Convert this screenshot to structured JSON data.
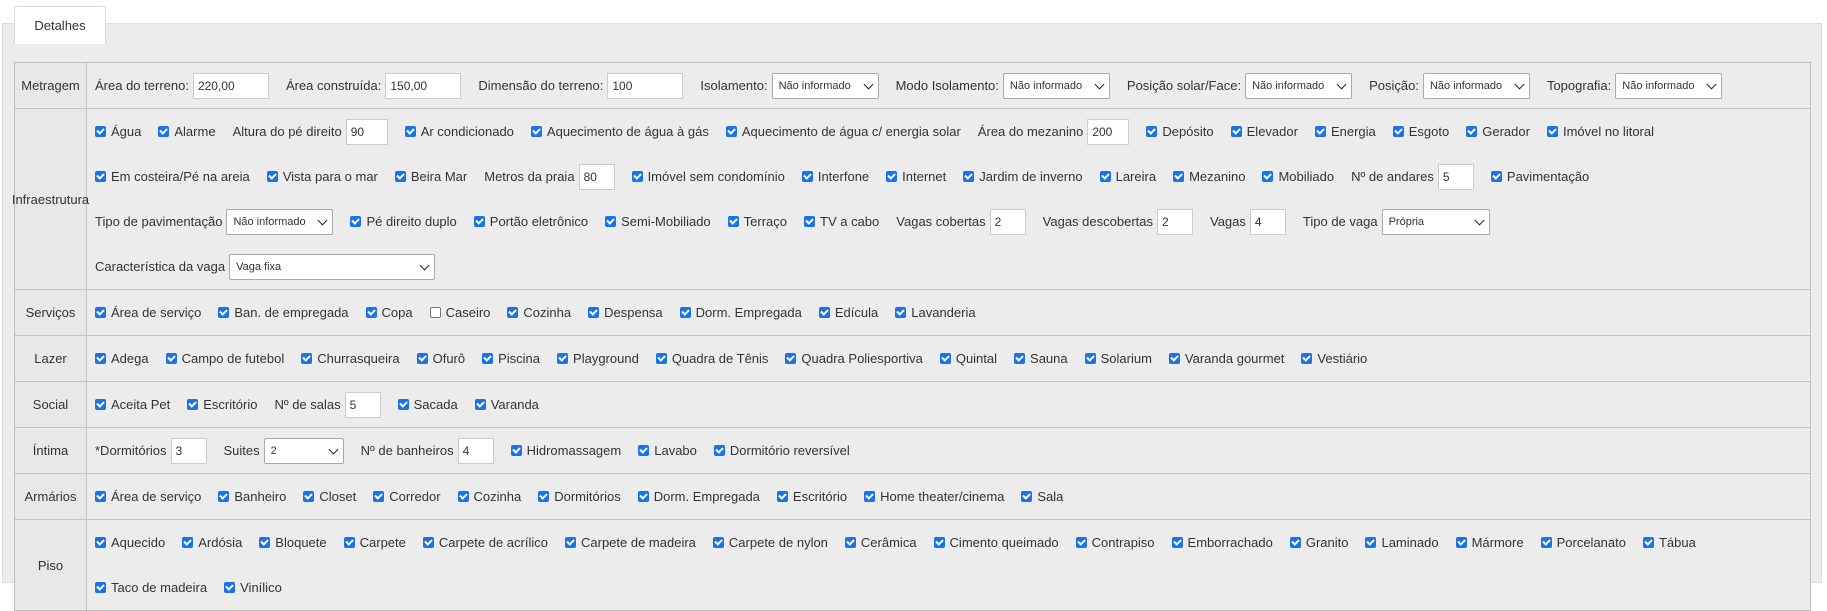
{
  "tab_label": "Detalhes",
  "rows": [
    {
      "label": "Metragem",
      "items": [
        {
          "type": "input",
          "label": "Área do terreno:",
          "value": "220,00",
          "w": 76
        },
        {
          "type": "input",
          "label": "Área construída:",
          "value": "150,00",
          "w": 76
        },
        {
          "type": "input",
          "label": "Dimensão do terreno:",
          "value": "100",
          "w": 76
        },
        {
          "type": "select",
          "label": "Isolamento:",
          "value": "Não informado",
          "w": 107
        },
        {
          "type": "select",
          "label": "Modo Isolamento:",
          "value": "Não informado",
          "w": 107
        },
        {
          "type": "select",
          "label": "Posição solar/Face:",
          "value": "Não informado",
          "w": 107
        },
        {
          "type": "select",
          "label": "Posição:",
          "value": "Não informado",
          "w": 107
        },
        {
          "type": "select",
          "label": "Topografia:",
          "value": "Não informado",
          "w": 107
        }
      ]
    },
    {
      "label": "Infraestrutura",
      "items": [
        {
          "type": "check",
          "label": "Água",
          "checked": true
        },
        {
          "type": "check",
          "label": "Alarme",
          "checked": true
        },
        {
          "type": "input",
          "label": "Altura do pé direito",
          "value": "90",
          "w": 42
        },
        {
          "type": "check",
          "label": "Ar condicionado",
          "checked": true
        },
        {
          "type": "check",
          "label": "Aquecimento de água à gás",
          "checked": true
        },
        {
          "type": "check",
          "label": "Aquecimento de água c/ energia solar",
          "checked": true
        },
        {
          "type": "input",
          "label": "Área do mezanino",
          "value": "200",
          "w": 42
        },
        {
          "type": "check",
          "label": "Depósito",
          "checked": true
        },
        {
          "type": "check",
          "label": "Elevador",
          "checked": true
        },
        {
          "type": "check",
          "label": "Energia",
          "checked": true
        },
        {
          "type": "check",
          "label": "Esgoto",
          "checked": true
        },
        {
          "type": "check",
          "label": "Gerador",
          "checked": true
        },
        {
          "type": "check",
          "label": "Imóvel no litoral",
          "checked": true
        },
        {
          "type": "check",
          "label": "Em costeira/Pé na areia",
          "checked": true
        },
        {
          "type": "check",
          "label": "Vista para o mar",
          "checked": true
        },
        {
          "type": "check",
          "label": "Beira Mar",
          "checked": true
        },
        {
          "type": "input",
          "label": "Metros da praia",
          "value": "80",
          "w": 36
        },
        {
          "type": "check",
          "label": "Imóvel sem condomínio",
          "checked": true
        },
        {
          "type": "check",
          "label": "Interfone",
          "checked": true
        },
        {
          "type": "check",
          "label": "Internet",
          "checked": true
        },
        {
          "type": "check",
          "label": "Jardim de inverno",
          "checked": true
        },
        {
          "type": "check",
          "label": "Lareira",
          "checked": true
        },
        {
          "type": "check",
          "label": "Mezanino",
          "checked": true
        },
        {
          "type": "check",
          "label": "Mobiliado",
          "checked": true
        },
        {
          "type": "input",
          "label": "Nº de andares",
          "value": "5",
          "w": 36
        },
        {
          "type": "check",
          "label": "Pavimentação",
          "checked": true
        },
        {
          "type": "select",
          "label": "Tipo de pavimentação",
          "value": "Não informado",
          "w": 107
        },
        {
          "type": "check",
          "label": "Pé direito duplo",
          "checked": true
        },
        {
          "type": "check",
          "label": "Portão eletrônico",
          "checked": true
        },
        {
          "type": "check",
          "label": "Semi-Mobiliado",
          "checked": true
        },
        {
          "type": "check",
          "label": "Terraço",
          "checked": true
        },
        {
          "type": "check",
          "label": "TV a cabo",
          "checked": true
        },
        {
          "type": "input",
          "label": "Vagas cobertas",
          "value": "2",
          "w": 36
        },
        {
          "type": "input",
          "label": "Vagas descobertas",
          "value": "2",
          "w": 36
        },
        {
          "type": "input",
          "label": "Vagas",
          "value": "4",
          "w": 36
        },
        {
          "type": "select",
          "label": "Tipo de vaga",
          "value": "Própria",
          "w": 108
        },
        {
          "type": "select",
          "label": "Característica da vaga",
          "value": "Vaga fixa",
          "w": 206
        }
      ]
    },
    {
      "label": "Serviços",
      "items": [
        {
          "type": "check",
          "label": "Área de serviço",
          "checked": true
        },
        {
          "type": "check",
          "label": "Ban. de empregada",
          "checked": true
        },
        {
          "type": "check",
          "label": "Copa",
          "checked": true
        },
        {
          "type": "check",
          "label": "Caseiro",
          "checked": false
        },
        {
          "type": "check",
          "label": "Cozinha",
          "checked": true
        },
        {
          "type": "check",
          "label": "Despensa",
          "checked": true
        },
        {
          "type": "check",
          "label": "Dorm. Empregada",
          "checked": true
        },
        {
          "type": "check",
          "label": "Edícula",
          "checked": true
        },
        {
          "type": "check",
          "label": "Lavanderia",
          "checked": true
        }
      ]
    },
    {
      "label": "Lazer",
      "items": [
        {
          "type": "check",
          "label": "Adega",
          "checked": true
        },
        {
          "type": "check",
          "label": "Campo de futebol",
          "checked": true
        },
        {
          "type": "check",
          "label": "Churrasqueira",
          "checked": true
        },
        {
          "type": "check",
          "label": "Ofurô",
          "checked": true
        },
        {
          "type": "check",
          "label": "Piscina",
          "checked": true
        },
        {
          "type": "check",
          "label": "Playground",
          "checked": true
        },
        {
          "type": "check",
          "label": "Quadra de Tênis",
          "checked": true
        },
        {
          "type": "check",
          "label": "Quadra Poliesportiva",
          "checked": true
        },
        {
          "type": "check",
          "label": "Quintal",
          "checked": true
        },
        {
          "type": "check",
          "label": "Sauna",
          "checked": true
        },
        {
          "type": "check",
          "label": "Solarium",
          "checked": true
        },
        {
          "type": "check",
          "label": "Varanda gourmet",
          "checked": true
        },
        {
          "type": "check",
          "label": "Vestiário",
          "checked": true
        }
      ]
    },
    {
      "label": "Social",
      "items": [
        {
          "type": "check",
          "label": "Aceita Pet",
          "checked": true
        },
        {
          "type": "check",
          "label": "Escritório",
          "checked": true
        },
        {
          "type": "input",
          "label": "Nº de salas",
          "value": "5",
          "w": 36
        },
        {
          "type": "check",
          "label": "Sacada",
          "checked": true
        },
        {
          "type": "check",
          "label": "Varanda",
          "checked": true
        }
      ]
    },
    {
      "label": "Íntima",
      "items": [
        {
          "type": "input",
          "label": "*Dormitórios",
          "value": "3",
          "w": 36
        },
        {
          "type": "select",
          "label": "Suites",
          "value": "2",
          "w": 80
        },
        {
          "type": "input",
          "label": "Nº de banheiros",
          "value": "4",
          "w": 36
        },
        {
          "type": "check",
          "label": "Hidromassagem",
          "checked": true
        },
        {
          "type": "check",
          "label": "Lavabo",
          "checked": true
        },
        {
          "type": "check",
          "label": "Dormitório reversível",
          "checked": true
        }
      ]
    },
    {
      "label": "Armários",
      "items": [
        {
          "type": "check",
          "label": "Área de serviço",
          "checked": true
        },
        {
          "type": "check",
          "label": "Banheiro",
          "checked": true
        },
        {
          "type": "check",
          "label": "Closet",
          "checked": true
        },
        {
          "type": "check",
          "label": "Corredor",
          "checked": true
        },
        {
          "type": "check",
          "label": "Cozinha",
          "checked": true
        },
        {
          "type": "check",
          "label": "Dormitórios",
          "checked": true
        },
        {
          "type": "check",
          "label": "Dorm. Empregada",
          "checked": true
        },
        {
          "type": "check",
          "label": "Escritório",
          "checked": true
        },
        {
          "type": "check",
          "label": "Home theater/cinema",
          "checked": true
        },
        {
          "type": "check",
          "label": "Sala",
          "checked": true
        }
      ]
    },
    {
      "label": "Piso",
      "items": [
        {
          "type": "check",
          "label": "Aquecido",
          "checked": true
        },
        {
          "type": "check",
          "label": "Ardósia",
          "checked": true
        },
        {
          "type": "check",
          "label": "Bloquete",
          "checked": true
        },
        {
          "type": "check",
          "label": "Carpete",
          "checked": true
        },
        {
          "type": "check",
          "label": "Carpete de acrílico",
          "checked": true
        },
        {
          "type": "check",
          "label": "Carpete de madeira",
          "checked": true
        },
        {
          "type": "check",
          "label": "Carpete de nylon",
          "checked": true
        },
        {
          "type": "check",
          "label": "Cerâmica",
          "checked": true
        },
        {
          "type": "check",
          "label": "Cimento queimado",
          "checked": true
        },
        {
          "type": "check",
          "label": "Contrapiso",
          "checked": true
        },
        {
          "type": "check",
          "label": "Emborrachado",
          "checked": true
        },
        {
          "type": "check",
          "label": "Granito",
          "checked": true
        },
        {
          "type": "check",
          "label": "Laminado",
          "checked": true
        },
        {
          "type": "check",
          "label": "Mármore",
          "checked": true
        },
        {
          "type": "check",
          "label": "Porcelanato",
          "checked": true
        },
        {
          "type": "check",
          "label": "Tábua",
          "checked": true
        },
        {
          "type": "check",
          "label": "Taco de madeira",
          "checked": true
        },
        {
          "type": "check",
          "label": "Vinílico",
          "checked": true
        }
      ]
    }
  ]
}
